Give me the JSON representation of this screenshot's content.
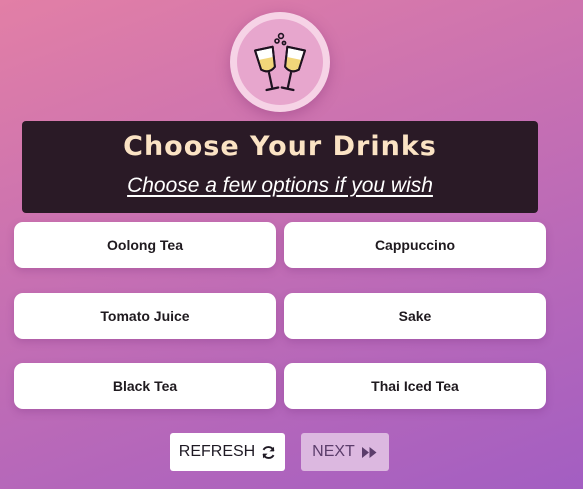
{
  "header": {
    "title": "Choose Your Drinks",
    "subtitle": "Choose a few options if you wish"
  },
  "logo": {
    "icon": "champagne-glasses-icon"
  },
  "options": [
    {
      "label": "Oolong Tea"
    },
    {
      "label": "Cappuccino"
    },
    {
      "label": "Tomato Juice"
    },
    {
      "label": "Sake"
    },
    {
      "label": "Black Tea"
    },
    {
      "label": "Thai Iced Tea"
    }
  ],
  "actions": {
    "refresh_label": "REFRESH",
    "refresh_icon": "refresh-icon",
    "next_label": "NEXT",
    "next_icon": "fast-forward-icon"
  },
  "colors": {
    "header_background": "#2a1a26",
    "title_color": "#fbe3c4",
    "next_button_background": "#dcb8e0"
  }
}
